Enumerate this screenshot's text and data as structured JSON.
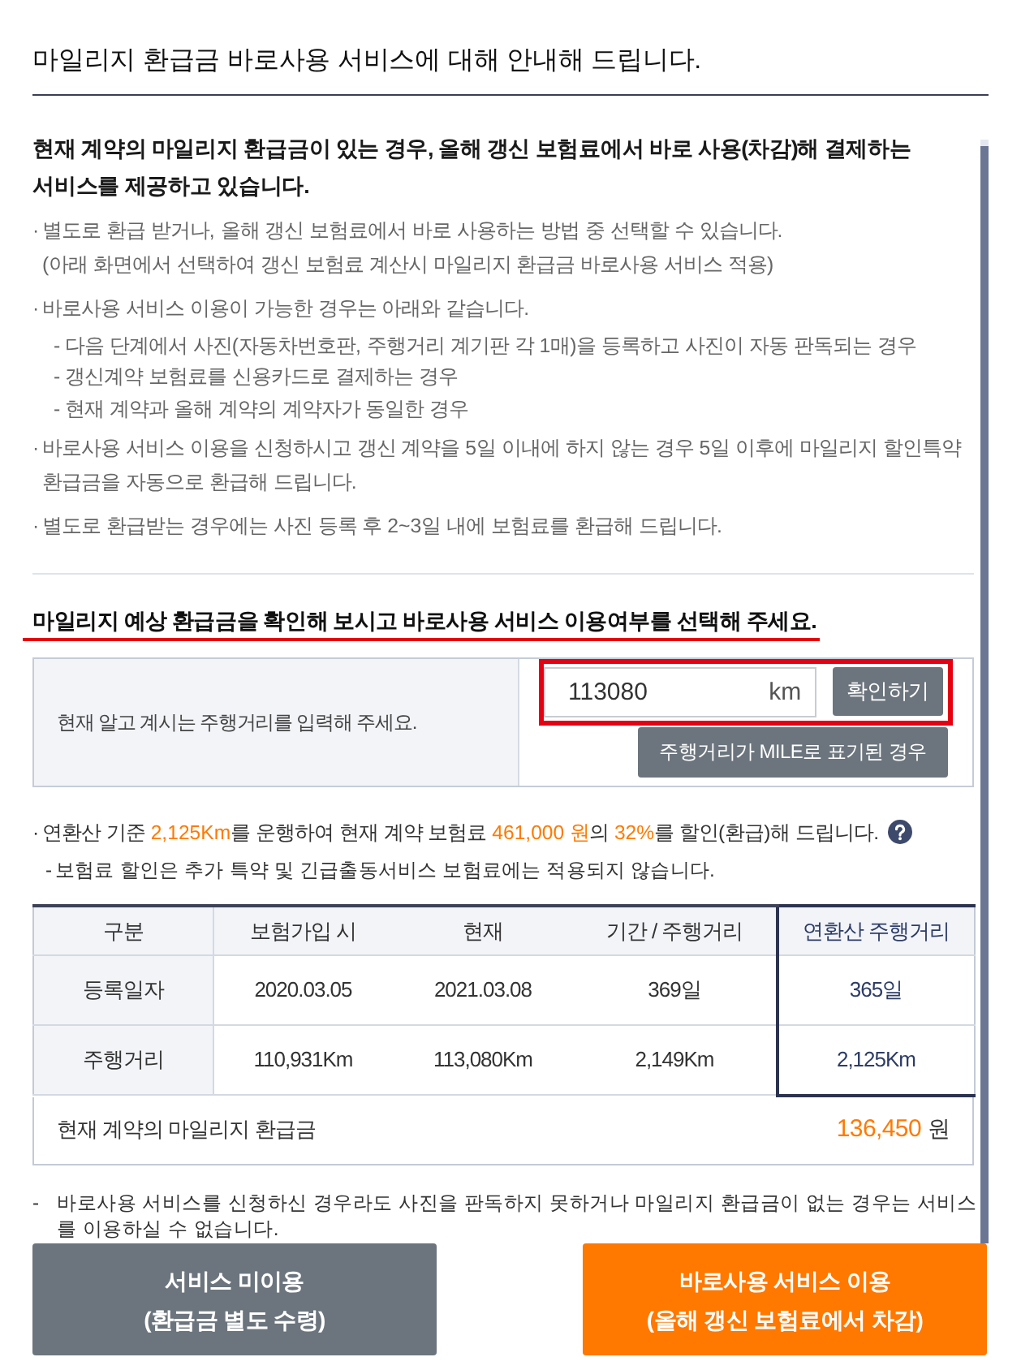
{
  "title": "마일리지 환급금 바로사용 서비스에 대해 안내해 드립니다.",
  "intro": "현재 계약의 마일리지 환급금이 있는 경우, 올해 갱신 보험료에서 바로 사용(차감)해 결제하는 서비스를 제공하고 있습니다.",
  "notes": [
    {
      "marker": "·",
      "text": "별도로 환급 받거나, 올해 갱신 보험료에서 바로 사용하는 방법 중 선택할 수 있습니다.\n(아래 화면에서 선택하여 갱신 보험료 계산시 마일리지 환급금 바로사용 서비스 적용)"
    },
    {
      "marker": "·",
      "text": "바로사용 서비스 이용이 가능한 경우는 아래와 같습니다.",
      "children": [
        {
          "marker": "-",
          "text": "다음 단계에서 사진(자동차번호판, 주행거리 계기판 각 1매)을 등록하고 사진이 자동 판독되는 경우"
        },
        {
          "marker": "-",
          "text": "갱신계약 보험료를 신용카드로 결제하는 경우"
        },
        {
          "marker": "-",
          "text": "현재 계약과 올해 계약의 계약자가 동일한 경우"
        }
      ]
    },
    {
      "marker": "·",
      "text": "바로사용 서비스 이용을 신청하시고 갱신 계약을 5일 이내에 하지 않는 경우 5일 이후에 마일리지 할인특약 환급금을 자동으로 환급해 드립니다."
    },
    {
      "marker": "·",
      "text": "별도로 환급받는 경우에는 사진 등록 후 2~3일 내에 보험료를 환급해 드립니다."
    }
  ],
  "selection": {
    "heading": "마일리지 예상 환급금을 확인해 보시고 바로사용 서비스 이용여부를 선택해 주세요.",
    "heading_underlined": true
  },
  "mileage_form": {
    "prompt": "현재 알고 계시는 주행거리를 입력해 주세요.",
    "input_value": "113080",
    "unit": "km",
    "confirm_button": "확인하기",
    "highlighted": true,
    "mile_button": "주행거리가 MILE로 표기된 경우"
  },
  "summary": {
    "marker": "·",
    "text": "연환산 기준 **2,125Km**를 운행하여 현재 계약 보험료 **461,000 원**의 **32%**를 할인(환급)해 드립니다."
  },
  "summary_note": {
    "marker": "-",
    "text": "보험료 할인은 추가 특약 및 긴급출동서비스 보험료에는 적용되지 않습니다."
  },
  "table": {
    "columns": [
      {
        "label": "구분",
        "highlighted": false
      },
      {
        "label": "보험가입 시",
        "highlighted": false
      },
      {
        "label": "현재",
        "highlighted": false
      },
      {
        "label": "기간 / 주행거리",
        "highlighted": false
      },
      {
        "label": "연환산 주행거리",
        "highlighted": true
      }
    ],
    "rows": [
      [
        "등록일자",
        "2020.03.05",
        "2021.03.08",
        "369일",
        "365일"
      ],
      [
        "주행거리",
        "110,931Km",
        "113,080Km",
        "2,149Km",
        "2,125Km"
      ]
    ],
    "footer": {
      "label": "현재 계약의 마일리지 환급금",
      "amount": "136,450",
      "unit": "원"
    }
  },
  "notice": {
    "marker": "-",
    "text": "바로사용 서비스를 신청하신 경우라도 사진을 판독하지 못하거나 마일리지 환급금이 없는 경우는 서비스를 이용하실 수 없습니다."
  },
  "buttons": [
    {
      "kind": "secondary",
      "label": "서비스 미이용\n(환급금 별도 수령)"
    },
    {
      "kind": "primary",
      "label": "바로사용 서비스 이용\n(올해 갱신 보험료에서 차감)"
    }
  ]
}
